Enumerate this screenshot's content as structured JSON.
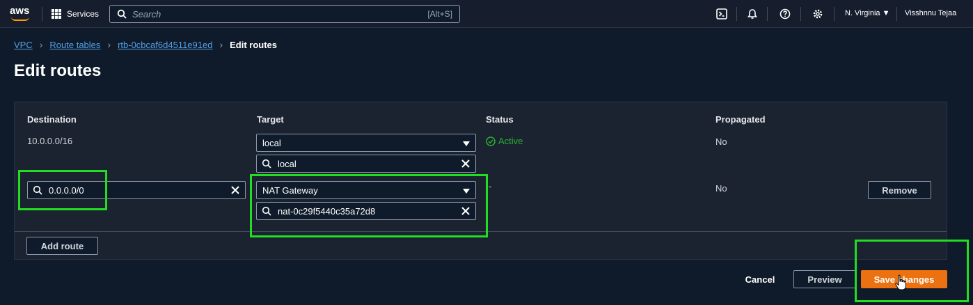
{
  "topnav": {
    "logo_text": "aws",
    "services_label": "Services",
    "search_placeholder": "Search",
    "search_shortcut": "[Alt+S]",
    "region_label": "N. Virginia ▼",
    "user_label": "Visshnnu Tejaa"
  },
  "breadcrumb": {
    "items": [
      "VPC",
      "Route tables",
      "rtb-0cbcaf6d4511e91ed"
    ],
    "current": "Edit routes"
  },
  "page_title": "Edit routes",
  "table": {
    "headers": {
      "destination": "Destination",
      "target": "Target",
      "status": "Status",
      "propagated": "Propagated"
    },
    "rows": [
      {
        "destination": "10.0.0.0/16",
        "target_type": "local",
        "target_filter": "local",
        "status": "Active",
        "propagated": "No"
      },
      {
        "destination": "0.0.0.0/0",
        "target_type": "NAT Gateway",
        "target_filter": "nat-0c29f5440c35a72d8",
        "status": "-",
        "propagated": "No",
        "remove_label": "Remove"
      }
    ],
    "add_route_label": "Add route"
  },
  "actions": {
    "cancel_label": "Cancel",
    "preview_label": "Preview",
    "save_label": "Save changes"
  },
  "colors": {
    "accent_primary": "#ec7211",
    "link": "#539fe5",
    "status_active": "#29ad32",
    "highlight": "#22dd22",
    "background": "#0f1b2a"
  }
}
